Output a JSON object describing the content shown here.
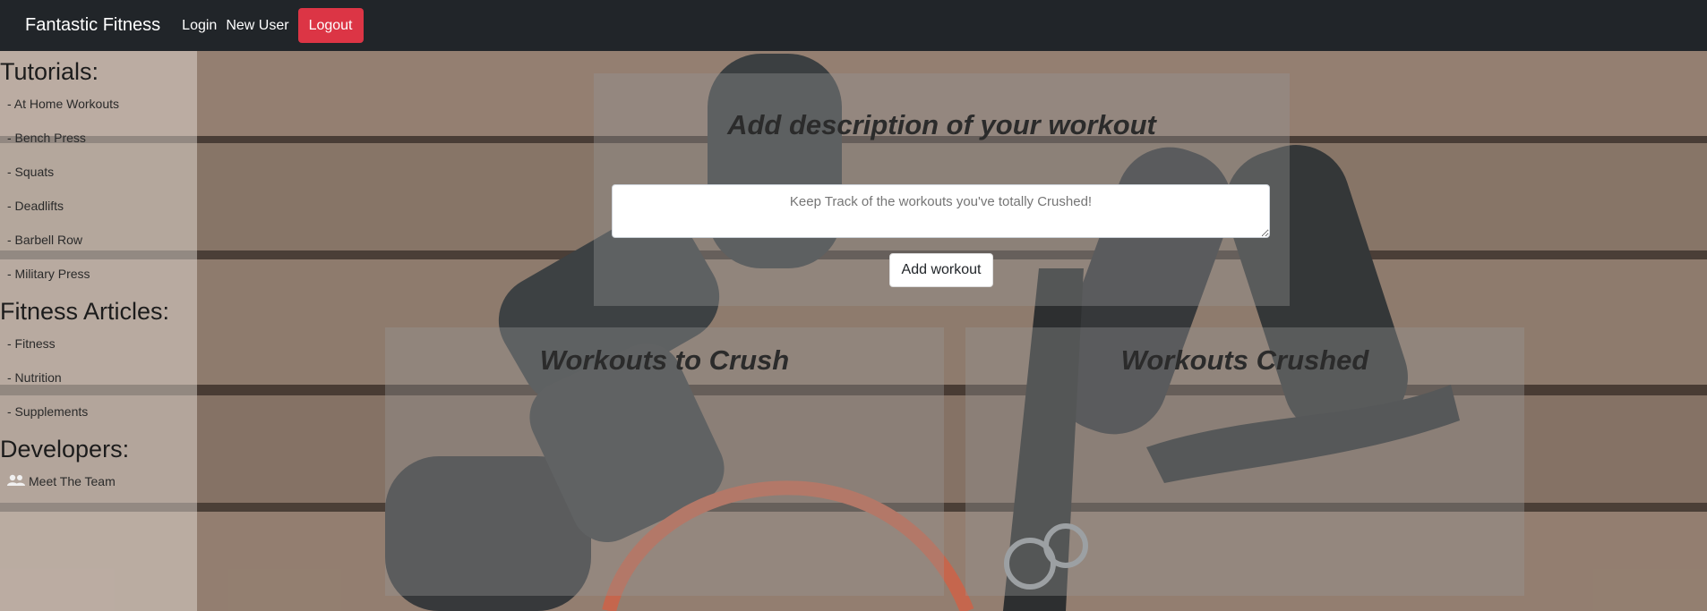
{
  "navbar": {
    "brand": "Fantastic Fitness",
    "login": "Login",
    "new_user": "New User",
    "logout": "Logout"
  },
  "sidebar": {
    "tutorials_heading": "Tutorials:",
    "tutorials": [
      "- At Home Workouts",
      "- Bench Press",
      "- Squats",
      "- Deadlifts",
      "- Barbell Row",
      "- Military Press"
    ],
    "articles_heading": "Fitness Articles:",
    "articles": [
      "- Fitness",
      "- Nutrition",
      "- Supplements"
    ],
    "developers_heading": "Developers:",
    "meet_team": "Meet The Team"
  },
  "workout_form": {
    "title": "Add description of your workout",
    "placeholder": "Keep Track of the workouts you've totally Crushed!",
    "button": "Add workout"
  },
  "lists": {
    "to_crush_title": "Workouts to Crush",
    "crushed_title": "Workouts Crushed"
  },
  "colors": {
    "navbar_bg": "#212529",
    "logout_bg": "#dc3545"
  }
}
